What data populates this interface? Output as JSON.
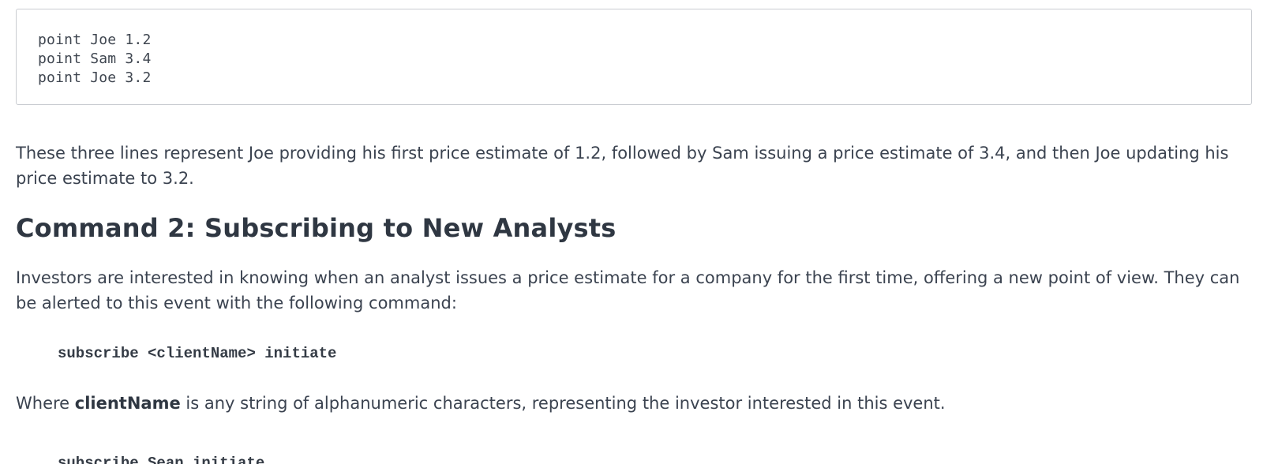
{
  "code_block": {
    "lines": [
      "point Joe 1.2",
      "point Sam 3.4",
      "point Joe 3.2"
    ]
  },
  "paragraph_1": "These three lines represent Joe providing his first price estimate of 1.2, followed by Sam issuing a price estimate of 3.4, and then Joe updating his price estimate to 3.2.",
  "section_heading": "Command 2: Subscribing to New Analysts",
  "paragraph_2": "Investors are interested in knowing when an analyst issues a price estimate for a company for the first time, offering a new point of view. They can be alerted to this event with the following command:",
  "command_syntax": "subscribe <clientName> initiate",
  "paragraph_3": {
    "prefix": "Where ",
    "term": "clientName",
    "suffix": " is any string of alphanumeric characters, representing the investor interested in this event."
  },
  "command_example": "subscribe Sean initiate"
}
